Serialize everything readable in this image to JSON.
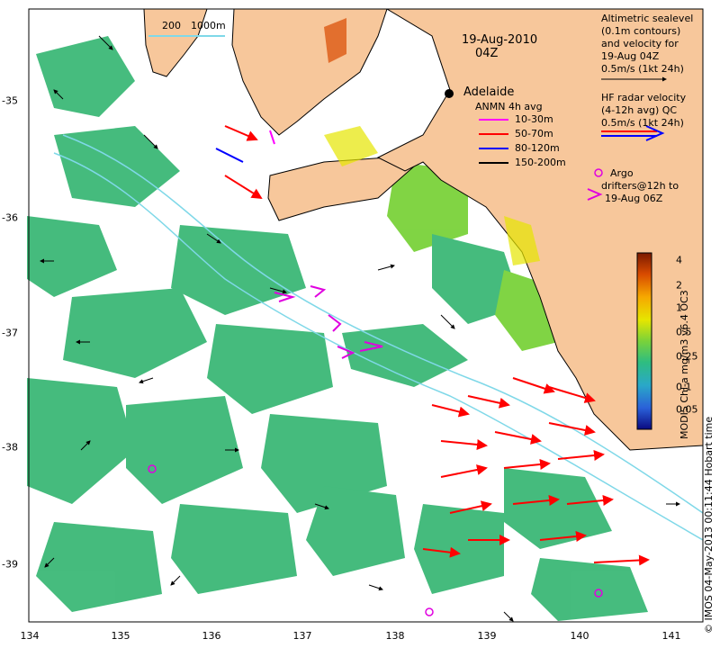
{
  "map": {
    "date": "19-Aug-2010",
    "time": "04Z",
    "city": "Adelaide",
    "scale_labels": [
      "200",
      "1000m"
    ],
    "x_ticks": [
      "134",
      "135",
      "136",
      "137",
      "138",
      "139",
      "140",
      "141"
    ],
    "y_ticks": [
      "-35",
      "-36",
      "-37",
      "-38",
      "-39"
    ],
    "colors": {
      "land": "#f7c79b",
      "ocean": "#ffffff",
      "hf_radar": "#ff0000",
      "argo": "#e000e0"
    }
  },
  "altimetry_legend": {
    "lines": [
      "Altimetric sealevel",
      "(0.1m contours)",
      "and velocity for",
      "19-Aug 04Z",
      "0.5m/s (1kt 24h)"
    ]
  },
  "hf_legend": {
    "lines": [
      "HF radar velocity",
      "(4-12h avg) QC",
      "0.5m/s (1kt 24h)"
    ]
  },
  "anmn_legend": {
    "title": "ANMN 4h avg",
    "items": [
      {
        "label": "10-30m",
        "color": "#ff00ff"
      },
      {
        "label": "50-70m",
        "color": "#ff0000"
      },
      {
        "label": "80-120m",
        "color": "#0000ff"
      },
      {
        "label": "150-200m",
        "color": "#000000"
      }
    ]
  },
  "argo_legend": {
    "lines": [
      "Argo",
      "drifters@12h to",
      "19-Aug 06Z"
    ]
  },
  "colorbar": {
    "title": "MODIS Chl-a mg/m3 v6.4 OC3",
    "ticks": [
      "4",
      "2",
      "1",
      "0.5",
      "0.25",
      "0.1",
      "0.05"
    ]
  },
  "credit": "© IMOS 04-May-2013 00:11:44 Hobart time"
}
